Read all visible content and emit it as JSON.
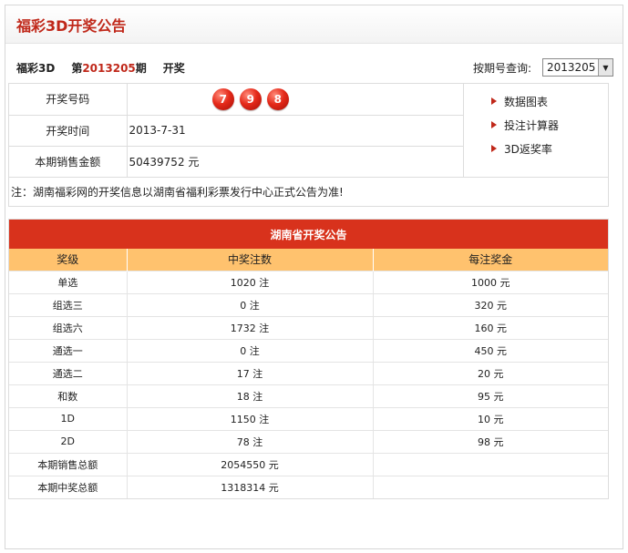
{
  "header": {
    "title": "福彩3D开奖公告"
  },
  "issue": {
    "game": "福彩3D",
    "prefix": "第",
    "number": "2013205",
    "suffix": "期",
    "draw": "开奖",
    "query_label": "按期号查询:",
    "selected_issue": "2013205"
  },
  "info": {
    "numbers_label": "开奖号码",
    "balls": [
      "7",
      "9",
      "8"
    ],
    "time_label": "开奖时间",
    "time_value": "2013-7-31",
    "sales_label": "本期销售金额",
    "sales_value": "50439752 元"
  },
  "links": [
    {
      "label": "数据图表"
    },
    {
      "label": "投注计算器"
    },
    {
      "label": "3D返奖率"
    }
  ],
  "note": "注：湖南福彩网的开奖信息以湖南省福利彩票发行中心正式公告为准!",
  "result": {
    "title": "湖南省开奖公告",
    "headers": [
      "奖级",
      "中奖注数",
      "每注奖金"
    ],
    "rows": [
      [
        "单选",
        "1020 注",
        "1000 元"
      ],
      [
        "组选三",
        "0 注",
        "320 元"
      ],
      [
        "组选六",
        "1732 注",
        "160 元"
      ],
      [
        "通选一",
        "0 注",
        "450 元"
      ],
      [
        "通选二",
        "17 注",
        "20 元"
      ],
      [
        "和数",
        "18 注",
        "95 元"
      ],
      [
        "1D",
        "1150 注",
        "10 元"
      ],
      [
        "2D",
        "78 注",
        "98 元"
      ],
      [
        "本期销售总额",
        "2054550 元",
        ""
      ],
      [
        "本期中奖总额",
        "1318314 元",
        ""
      ]
    ]
  },
  "colors": {
    "accent": "#c0281a",
    "title_bar": "#d8321c",
    "header_row": "#ffc26e"
  }
}
